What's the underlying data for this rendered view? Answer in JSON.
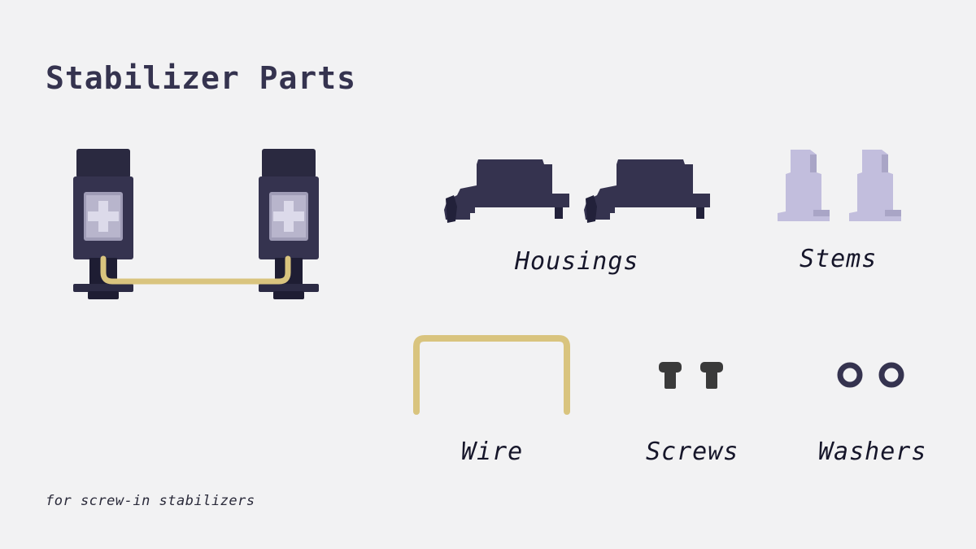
{
  "title": "Stabilizer Parts",
  "parts": {
    "housings": "Housings",
    "stems": "Stems",
    "wire": "Wire",
    "screws": "Screws",
    "washers": "Washers"
  },
  "footnote": "for screw-in stabilizers",
  "colors": {
    "background": "#f2f2f3",
    "housing": "#35334f",
    "housing_dark": "#22213a",
    "stem": "#c2bedd",
    "wire": "#d9c47e",
    "screw": "#3a3a3a",
    "text": "#35334f"
  }
}
